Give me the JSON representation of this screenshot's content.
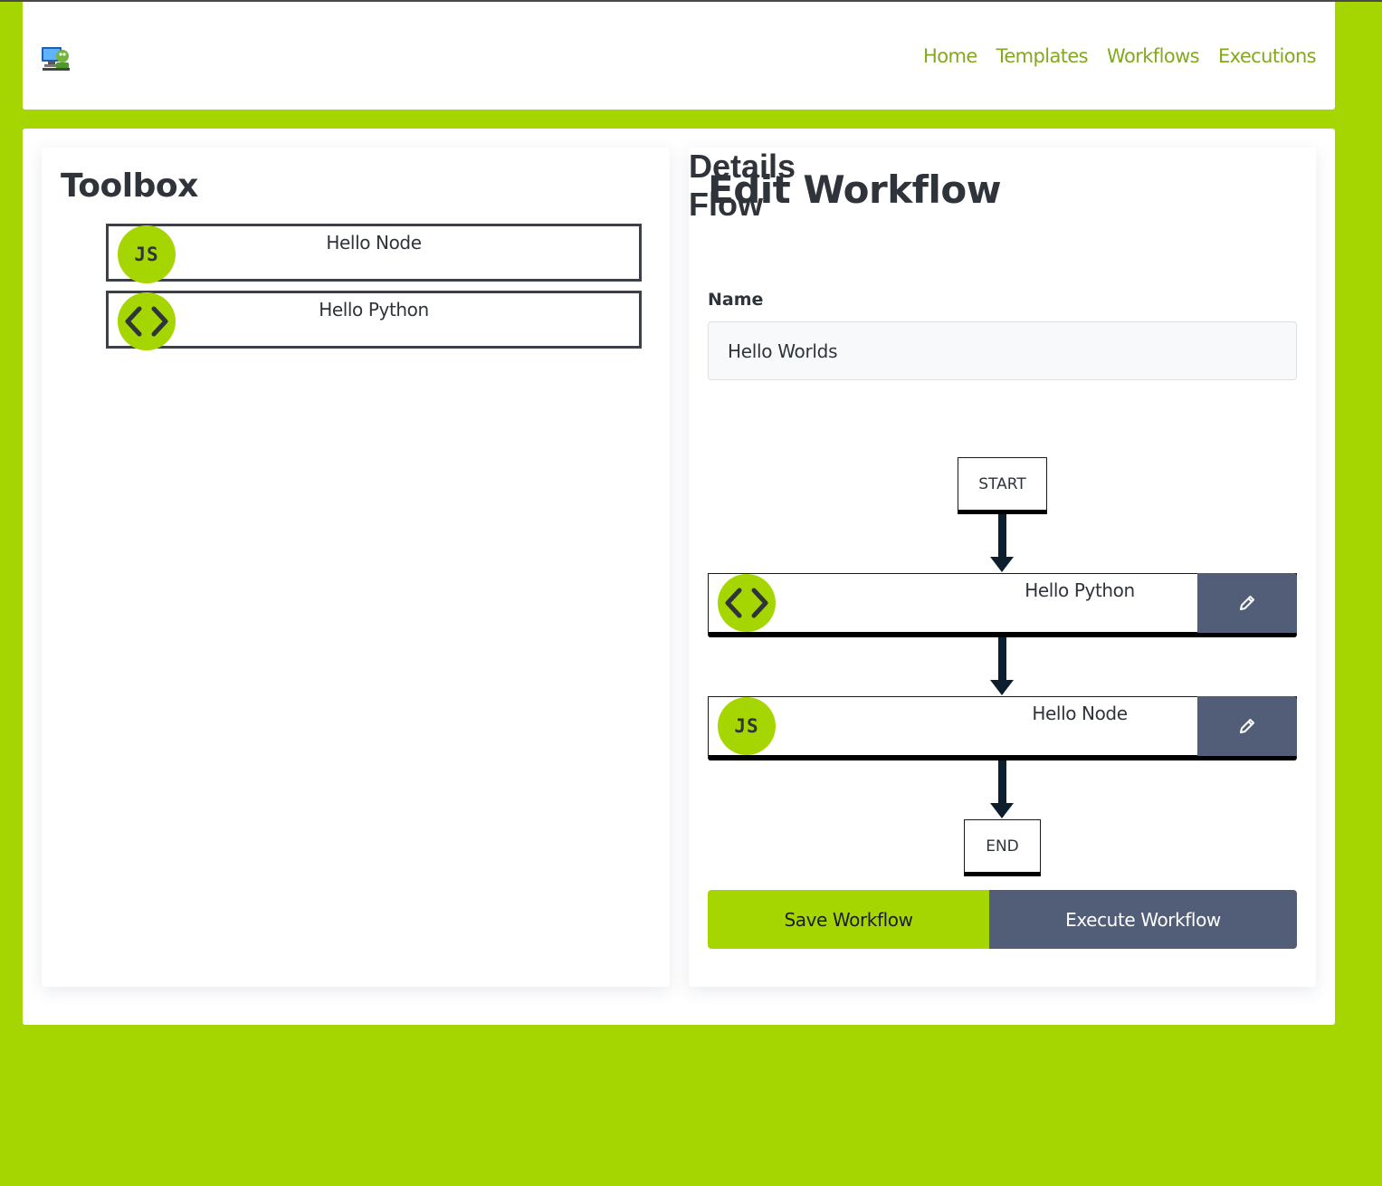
{
  "nav": {
    "logo_icon": "robot-computer-logo",
    "items": [
      "Home",
      "Templates",
      "Workflows",
      "Executions"
    ]
  },
  "toolbox": {
    "title": "Toolbox",
    "items": [
      {
        "label": "Hello Node",
        "icon": "js-icon",
        "icon_text": "JS"
      },
      {
        "label": "Hello Python",
        "icon": "code-brackets-icon"
      }
    ]
  },
  "editor": {
    "title": "Edit Workflow",
    "details_title": "Details",
    "name_label": "Name",
    "name_value": "Hello Worlds",
    "flow_title": "Flow",
    "flow": {
      "start_label": "START",
      "end_label": "END",
      "nodes": [
        {
          "label": "Hello Python",
          "icon": "code-brackets-icon"
        },
        {
          "label": "Hello Node",
          "icon": "js-icon",
          "icon_text": "JS"
        }
      ]
    },
    "save_label": "Save Workflow",
    "execute_label": "Execute Workflow"
  },
  "colors": {
    "background": "#a6d602",
    "accent": "#a6d602",
    "nav_link": "#84a81f",
    "slate": "#525e78",
    "text": "#2f343b"
  }
}
